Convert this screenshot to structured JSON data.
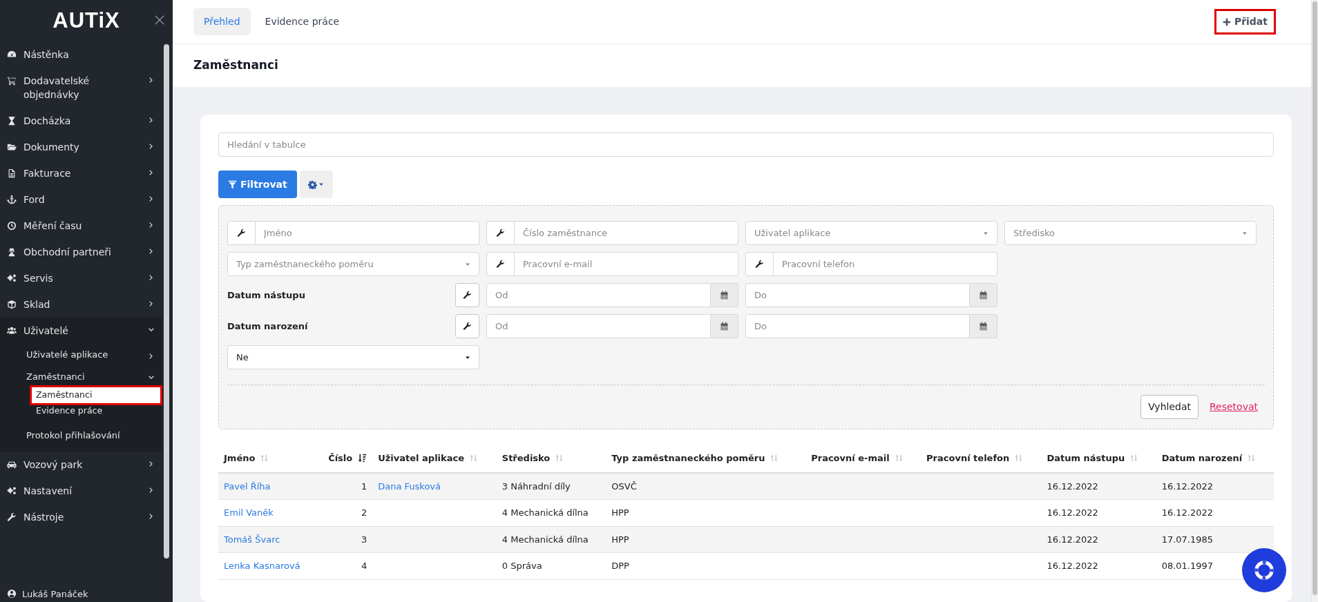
{
  "sidebar": {
    "logo": "AUTiX",
    "items": [
      {
        "label": "Nástěnka"
      },
      {
        "label": "Dodavatelské objednávky",
        "expanded": false
      },
      {
        "label": "Docházka",
        "expanded": false
      },
      {
        "label": "Dokumenty",
        "expanded": false
      },
      {
        "label": "Fakturace",
        "expanded": false
      },
      {
        "label": "Ford",
        "expanded": false
      },
      {
        "label": "Měření času",
        "expanded": false
      },
      {
        "label": "Obchodní partneři",
        "expanded": false
      },
      {
        "label": "Servis",
        "expanded": false
      },
      {
        "label": "Sklad",
        "expanded": false
      },
      {
        "label": "Uživatelé",
        "expanded": true,
        "children": [
          {
            "label": "Uživatelé aplikace",
            "expanded": false
          },
          {
            "label": "Zaměstnanci",
            "expanded": true,
            "children": [
              {
                "label": "Zaměstnanci",
                "selected": true,
                "highlighted": true
              },
              {
                "label": "Evidence práce",
                "selected": false,
                "highlighted": false
              }
            ]
          },
          {
            "label": "Protokol přihlašování"
          }
        ]
      },
      {
        "label": "Vozový park",
        "expanded": false
      },
      {
        "label": "Nastavení",
        "expanded": false
      },
      {
        "label": "Nástroje",
        "expanded": false
      }
    ],
    "user": "Lukáš Panáček"
  },
  "tabs": [
    {
      "label": "Přehled",
      "selected": true
    },
    {
      "label": "Evidence práce",
      "selected": false
    }
  ],
  "add_button": {
    "label": "Přidat",
    "highlighted": true
  },
  "page_title": "Zaměstnanci",
  "search": {
    "placeholder": "Hledání v tabulce"
  },
  "filter_button": "Filtrovat",
  "filters": [
    [
      {
        "kind": "text",
        "placeholder": "Jméno"
      },
      {
        "kind": "text",
        "placeholder": "Číslo zaměstnance"
      },
      {
        "kind": "select",
        "placeholder": "Uživatel aplikace"
      },
      {
        "kind": "select",
        "placeholder": "Středisko"
      }
    ],
    [
      {
        "kind": "select",
        "placeholder": "Typ zaměstnaneckého poměru"
      },
      {
        "kind": "text",
        "placeholder": "Pracovní e-mail"
      },
      {
        "kind": "text",
        "placeholder": "Pracovní telefon"
      }
    ],
    [
      {
        "kind": "date_range",
        "label": "Datum nástupu",
        "range": [
          {
            "placeholder": "Od"
          },
          {
            "placeholder": "Do"
          }
        ]
      }
    ],
    [
      {
        "kind": "date_range",
        "label": "Datum narození",
        "range": [
          {
            "placeholder": "Od"
          },
          {
            "placeholder": "Do"
          }
        ]
      }
    ],
    [
      {
        "kind": "select_value",
        "value": "Ne"
      }
    ]
  ],
  "filter_actions": {
    "search": "Vyhledat",
    "reset": "Resetovat"
  },
  "table": {
    "columns": [
      {
        "label": "Jméno",
        "sorted": false
      },
      {
        "label": "Číslo",
        "sorted": true
      },
      {
        "label": "Uživatel aplikace",
        "sorted": false
      },
      {
        "label": "Středisko",
        "sorted": false
      },
      {
        "label": "Typ zaměstnaneckého poměru",
        "sorted": false
      },
      {
        "label": "Pracovní e-mail",
        "sorted": false
      },
      {
        "label": "Pracovní telefon",
        "sorted": false
      },
      {
        "label": "Datum nástupu",
        "sorted": false
      },
      {
        "label": "Datum narození",
        "sorted": false
      }
    ],
    "rows": [
      [
        "Pavel Říha",
        "1",
        "Dana Fusková",
        "3 Náhradní díly",
        "OSVČ",
        "",
        "",
        "16.12.2022",
        "16.12.2022"
      ],
      [
        "Emil Vaněk",
        "2",
        "",
        "4 Mechanická dílna",
        "HPP",
        "",
        "",
        "16.12.2022",
        "16.12.2022"
      ],
      [
        "Tomáš Švarc",
        "3",
        "",
        "4 Mechanická dílna",
        "HPP",
        "",
        "",
        "16.12.2022",
        "17.07.1985"
      ],
      [
        "Lenka Kasnarová",
        "4",
        "",
        "0 Správa",
        "DPP",
        "",
        "",
        "16.12.2022",
        "08.01.1997"
      ]
    ]
  }
}
